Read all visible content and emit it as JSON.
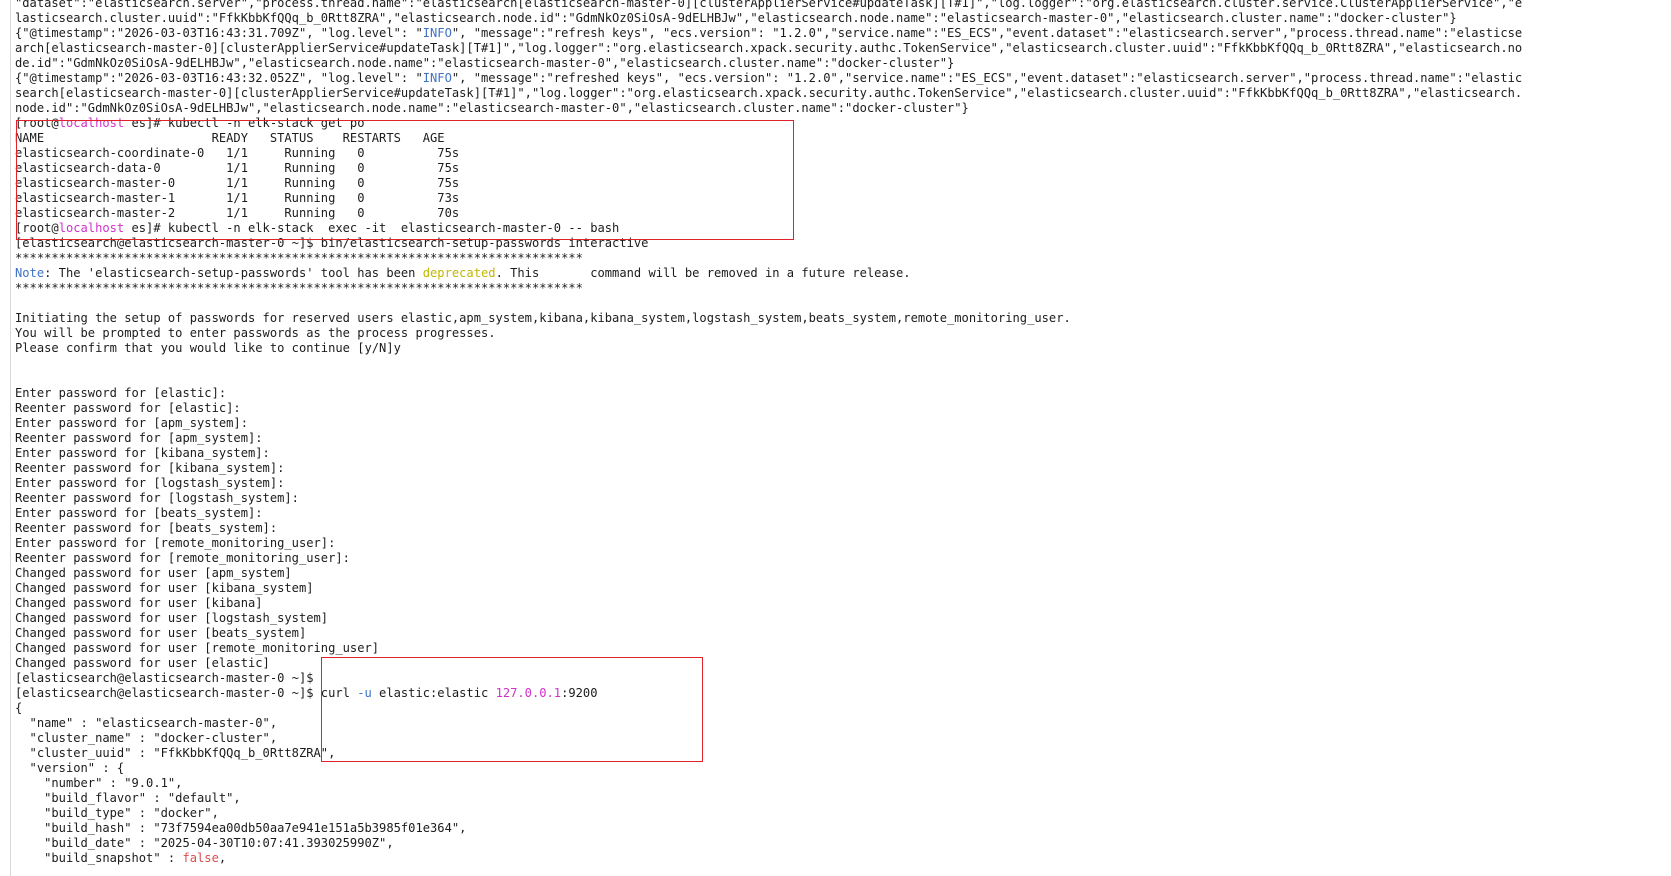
{
  "terminal": {
    "lines": [
      [
        {
          "t": "\"dataset\":\"elasticsearch.server\",\"process.thread.name\":\"elasticsearch[elasticsearch-master-0][clusterApplierService#updateTask][T#1]\",\"log.logger\":\"org.elasticsearch.cluster.service.ClusterApplierService\",\"e",
          "c": "default"
        }
      ],
      [
        {
          "t": "lasticsearch.cluster.uuid\":\"FfkKbbKfQQq_b_0Rtt8ZRA\",\"elasticsearch.node.id\":\"GdmNkOz0SiOsA-9dELHBJw\",\"elasticsearch.node.name\":\"elasticsearch-master-0\",\"elasticsearch.cluster.name\":\"docker-cluster\"}",
          "c": "default"
        }
      ],
      [
        {
          "t": "{\"@timestamp\":\"2026-03-03T16:43:31.709Z\", \"log.level\": \"",
          "c": "default"
        },
        {
          "t": "INFO",
          "c": "blue"
        },
        {
          "t": "\", \"message\":\"refresh keys\", \"ecs.version\": \"1.2.0\",\"service.name\":\"ES_ECS\",\"event.dataset\":\"elasticsearch.server\",\"process.thread.name\":\"elasticse",
          "c": "default"
        }
      ],
      [
        {
          "t": "arch[elasticsearch-master-0][clusterApplierService#updateTask][T#1]\",\"log.logger\":\"org.elasticsearch.xpack.security.authc.TokenService\",\"elasticsearch.cluster.uuid\":\"FfkKbbKfQQq_b_0Rtt8ZRA\",\"elasticsearch.no",
          "c": "default"
        }
      ],
      [
        {
          "t": "de.id\":\"GdmNkOz0SiOsA-9dELHBJw\",\"elasticsearch.node.name\":\"elasticsearch-master-0\",\"elasticsearch.cluster.name\":\"docker-cluster\"}",
          "c": "default"
        }
      ],
      [
        {
          "t": "{\"@timestamp\":\"2026-03-03T16:43:32.052Z\", \"log.level\": \"",
          "c": "default"
        },
        {
          "t": "INFO",
          "c": "blue"
        },
        {
          "t": "\", \"message\":\"refreshed keys\", \"ecs.version\": \"1.2.0\",\"service.name\":\"ES_ECS\",\"event.dataset\":\"elasticsearch.server\",\"process.thread.name\":\"elastic",
          "c": "default"
        }
      ],
      [
        {
          "t": "search[elasticsearch-master-0][clusterApplierService#updateTask][T#1]\",\"log.logger\":\"org.elasticsearch.xpack.security.authc.TokenService\",\"elasticsearch.cluster.uuid\":\"FfkKbbKfQQq_b_0Rtt8ZRA\",\"elasticsearch.",
          "c": "default"
        }
      ],
      [
        {
          "t": "node.id\":\"GdmNkOz0SiOsA-9dELHBJw\",\"elasticsearch.node.name\":\"elasticsearch-master-0\",\"elasticsearch.cluster.name\":\"docker-cluster\"}",
          "c": "default"
        }
      ],
      [
        {
          "t": "[root@",
          "c": "default"
        },
        {
          "t": "localhost",
          "c": "magenta"
        },
        {
          "t": " es]# kubectl -n elk-stack get po",
          "c": "default"
        }
      ],
      [
        {
          "t": "NAME                       READY   STATUS    RESTARTS   AGE",
          "c": "default"
        }
      ],
      [
        {
          "t": "elasticsearch-coordinate-0   1/1     Running   0          75s",
          "c": "default"
        }
      ],
      [
        {
          "t": "elasticsearch-data-0         1/1     Running   0          75s",
          "c": "default"
        }
      ],
      [
        {
          "t": "elasticsearch-master-0       1/1     Running   0          75s",
          "c": "default"
        }
      ],
      [
        {
          "t": "elasticsearch-master-1       1/1     Running   0          73s",
          "c": "default"
        }
      ],
      [
        {
          "t": "elasticsearch-master-2       1/1     Running   0          70s",
          "c": "default"
        }
      ],
      [
        {
          "t": "[root@",
          "c": "default"
        },
        {
          "t": "localhost",
          "c": "magenta"
        },
        {
          "t": " es]# kubectl -n elk-stack  exec -it  elasticsearch-master-0 -- bash",
          "c": "default"
        }
      ],
      [
        {
          "t": "[elasticsearch@elasticsearch-master-0 ~]$ bin/elasticsearch-setup-passwords interactive",
          "c": "default"
        }
      ],
      [
        {
          "t": "******************************************************************************",
          "c": "default"
        }
      ],
      [
        {
          "t": "Note",
          "c": "blue"
        },
        {
          "t": ": The 'elasticsearch-setup-passwords' tool has been ",
          "c": "default"
        },
        {
          "t": "deprecated",
          "c": "yellow"
        },
        {
          "t": ". This       command will be removed in a future release.",
          "c": "default"
        }
      ],
      [
        {
          "t": "******************************************************************************",
          "c": "default"
        }
      ],
      [
        {
          "t": "",
          "c": "default"
        }
      ],
      [
        {
          "t": "Initiating the setup of passwords for reserved users elastic,apm_system,kibana,kibana_system,logstash_system,beats_system,remote_monitoring_user.",
          "c": "default"
        }
      ],
      [
        {
          "t": "You will be prompted to enter passwords as the process progresses.",
          "c": "default"
        }
      ],
      [
        {
          "t": "Please confirm that you would like to continue [y/N]y",
          "c": "default"
        }
      ],
      [
        {
          "t": "",
          "c": "default"
        }
      ],
      [
        {
          "t": "",
          "c": "default"
        }
      ],
      [
        {
          "t": "Enter password for [elastic]:",
          "c": "default"
        }
      ],
      [
        {
          "t": "Reenter password for [elastic]:",
          "c": "default"
        }
      ],
      [
        {
          "t": "Enter password for [apm_system]:",
          "c": "default"
        }
      ],
      [
        {
          "t": "Reenter password for [apm_system]:",
          "c": "default"
        }
      ],
      [
        {
          "t": "Enter password for [kibana_system]:",
          "c": "default"
        }
      ],
      [
        {
          "t": "Reenter password for [kibana_system]:",
          "c": "default"
        }
      ],
      [
        {
          "t": "Enter password for [logstash_system]:",
          "c": "default"
        }
      ],
      [
        {
          "t": "Reenter password for [logstash_system]:",
          "c": "default"
        }
      ],
      [
        {
          "t": "Enter password for [beats_system]:",
          "c": "default"
        }
      ],
      [
        {
          "t": "Reenter password for [beats_system]:",
          "c": "default"
        }
      ],
      [
        {
          "t": "Enter password for [remote_monitoring_user]:",
          "c": "default"
        }
      ],
      [
        {
          "t": "Reenter password for [remote_monitoring_user]:",
          "c": "default"
        }
      ],
      [
        {
          "t": "Changed password for user [apm_system]",
          "c": "default"
        }
      ],
      [
        {
          "t": "Changed password for user [kibana_system]",
          "c": "default"
        }
      ],
      [
        {
          "t": "Changed password for user [kibana]",
          "c": "default"
        }
      ],
      [
        {
          "t": "Changed password for user [logstash_system]",
          "c": "default"
        }
      ],
      [
        {
          "t": "Changed password for user [beats_system]",
          "c": "default"
        }
      ],
      [
        {
          "t": "Changed password for user [remote_monitoring_user]",
          "c": "default"
        }
      ],
      [
        {
          "t": "Changed password for user [elastic]",
          "c": "default"
        }
      ],
      [
        {
          "t": "[elasticsearch@elasticsearch-master-0 ~]$",
          "c": "default"
        }
      ],
      [
        {
          "t": "[elasticsearch@elasticsearch-master-0 ~]$ curl ",
          "c": "default"
        },
        {
          "t": "-u",
          "c": "blue"
        },
        {
          "t": " elastic:elastic ",
          "c": "default"
        },
        {
          "t": "127.0.0.1",
          "c": "magenta"
        },
        {
          "t": ":9200",
          "c": "default"
        }
      ],
      [
        {
          "t": "{",
          "c": "default"
        }
      ],
      [
        {
          "t": "  \"name\" : \"elasticsearch-master-0\",",
          "c": "default"
        }
      ],
      [
        {
          "t": "  \"cluster_name\" : \"docker-cluster\",",
          "c": "default"
        }
      ],
      [
        {
          "t": "  \"cluster_uuid\" : \"FfkKbbKfQQq_b_0Rtt8ZRA\",",
          "c": "default"
        }
      ],
      [
        {
          "t": "  \"version\" : {",
          "c": "default"
        }
      ],
      [
        {
          "t": "    \"number\" : \"9.0.1\",",
          "c": "default"
        }
      ],
      [
        {
          "t": "    \"build_flavor\" : \"default\",",
          "c": "default"
        }
      ],
      [
        {
          "t": "    \"build_type\" : \"docker\",",
          "c": "default"
        }
      ],
      [
        {
          "t": "    \"build_hash\" : \"73f7594ea00db50aa7e941e151a5b3985f01e364\",",
          "c": "default"
        }
      ],
      [
        {
          "t": "    \"build_date\" : \"2025-04-30T10:07:41.393025990Z\",",
          "c": "default"
        }
      ],
      [
        {
          "t": "    \"build_snapshot\" : ",
          "c": "default"
        },
        {
          "t": "false",
          "c": "red"
        },
        {
          "t": ",",
          "c": "default"
        }
      ]
    ]
  },
  "colors": {
    "default": "#1c1c1c",
    "blue": "#3f72c5",
    "magenta": "#d033c8",
    "yellow": "#c1b700",
    "red": "#d94e4e",
    "highlight_box": "#e0222c",
    "background": "#ffffff"
  }
}
